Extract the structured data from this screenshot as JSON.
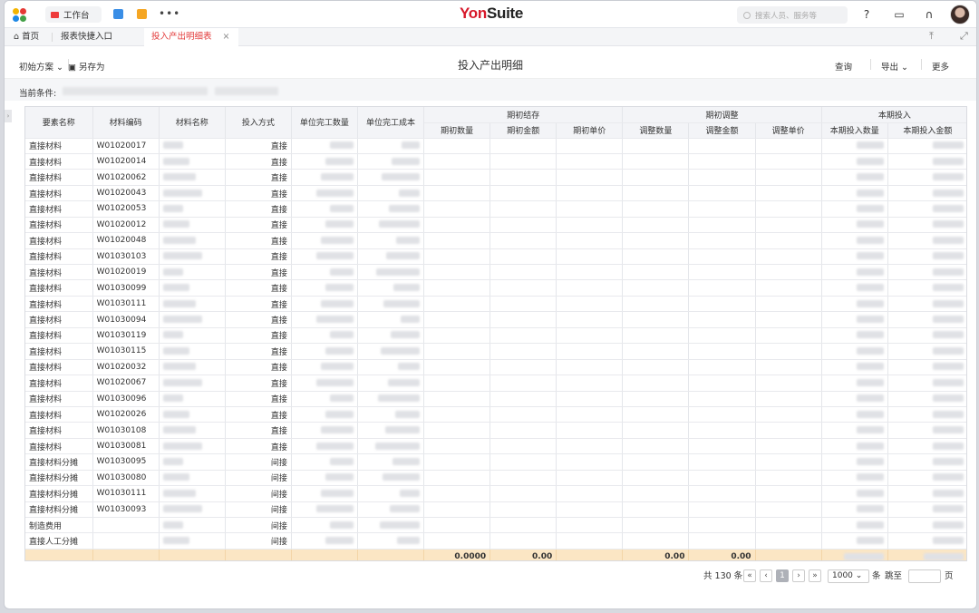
{
  "topbar": {
    "workbench": "工作台",
    "brand_a": "Yon",
    "brand_b": "Suite",
    "search_placeholder": "搜索人员、服务等",
    "more": "•••"
  },
  "tabs": {
    "home": "首页",
    "report": "报表快捷入口",
    "active": "投入产出明细表",
    "close": "×"
  },
  "toolbar": {
    "scheme": "初始方案",
    "save_as": "另存为",
    "title": "投入产出明细",
    "query": "查询",
    "export": "导出",
    "more": "更多"
  },
  "condition": {
    "label": "当前条件:"
  },
  "table": {
    "headers": {
      "element": "要素名称",
      "code": "材料编码",
      "name": "材料名称",
      "method": "投入方式",
      "unit_qty": "单位完工数量",
      "unit_cost": "单位完工成本",
      "open": "期初结存",
      "open_qty": "期初数量",
      "open_amt": "期初金额",
      "open_price": "期初单价",
      "adj": "期初调整",
      "adj_qty": "调整数量",
      "adj_amt": "调整金额",
      "adj_price": "调整单价",
      "cur": "本期投入",
      "cur_qty": "本期投入数量",
      "cur_amt": "本期投入金额"
    },
    "rows": [
      {
        "element": "直接材料",
        "code": "W01020017",
        "method": "直接"
      },
      {
        "element": "直接材料",
        "code": "W01020014",
        "method": "直接"
      },
      {
        "element": "直接材料",
        "code": "W01020062",
        "method": "直接"
      },
      {
        "element": "直接材料",
        "code": "W01020043",
        "method": "直接"
      },
      {
        "element": "直接材料",
        "code": "W01020053",
        "method": "直接"
      },
      {
        "element": "直接材料",
        "code": "W01020012",
        "method": "直接"
      },
      {
        "element": "直接材料",
        "code": "W01020048",
        "method": "直接"
      },
      {
        "element": "直接材料",
        "code": "W01030103",
        "method": "直接"
      },
      {
        "element": "直接材料",
        "code": "W01020019",
        "method": "直接"
      },
      {
        "element": "直接材料",
        "code": "W01030099",
        "method": "直接"
      },
      {
        "element": "直接材料",
        "code": "W01030111",
        "method": "直接"
      },
      {
        "element": "直接材料",
        "code": "W01030094",
        "method": "直接"
      },
      {
        "element": "直接材料",
        "code": "W01030119",
        "method": "直接"
      },
      {
        "element": "直接材料",
        "code": "W01030115",
        "method": "直接"
      },
      {
        "element": "直接材料",
        "code": "W01020032",
        "method": "直接"
      },
      {
        "element": "直接材料",
        "code": "W01020067",
        "method": "直接"
      },
      {
        "element": "直接材料",
        "code": "W01030096",
        "method": "直接"
      },
      {
        "element": "直接材料",
        "code": "W01020026",
        "method": "直接"
      },
      {
        "element": "直接材料",
        "code": "W01030108",
        "method": "直接"
      },
      {
        "element": "直接材料",
        "code": "W01030081",
        "method": "直接"
      },
      {
        "element": "直接材料分摊",
        "code": "W01030095",
        "method": "间接"
      },
      {
        "element": "直接材料分摊",
        "code": "W01030080",
        "method": "间接"
      },
      {
        "element": "直接材料分摊",
        "code": "W01030111",
        "method": "间接"
      },
      {
        "element": "直接材料分摊",
        "code": "W01030093",
        "method": "间接"
      },
      {
        "element": "制造费用",
        "code": "",
        "method": "间接"
      },
      {
        "element": "直接人工分摊",
        "code": "",
        "method": "间接"
      }
    ],
    "totals": {
      "open_qty": "0.0000",
      "open_amt": "0.00",
      "adj_qty": "0.00",
      "adj_amt": "0.00"
    }
  },
  "pager": {
    "total": "共 130 条",
    "page": "1",
    "size": "1000",
    "unit": "条",
    "goto": "跳至",
    "page_unit": "页"
  }
}
